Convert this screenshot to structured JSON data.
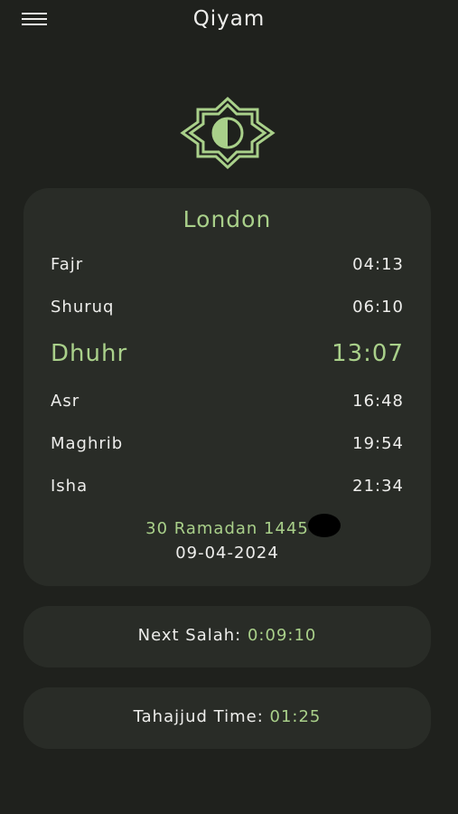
{
  "header": {
    "title": "Qiyam",
    "menu_icon": "hamburger-menu-icon"
  },
  "logo": {
    "icon": "eight-point-star-moon-icon",
    "color": "#a9d08a"
  },
  "prayer_card": {
    "city": "London",
    "prayers": [
      {
        "name": "Fajr",
        "time": "04:13"
      },
      {
        "name": "Shuruq",
        "time": "06:10"
      },
      {
        "name": "Dhuhr",
        "time": "13:07"
      },
      {
        "name": "Asr",
        "time": "16:48"
      },
      {
        "name": "Maghrib",
        "time": "19:54"
      },
      {
        "name": "Isha",
        "time": "21:34"
      }
    ],
    "active_prayer": "Dhuhr",
    "hijri_date": "30 Ramadan 1445",
    "gregorian_date": "09-04-2024"
  },
  "next_salah": {
    "label": "Next Salah:",
    "value": "0:09:10"
  },
  "tahajjud": {
    "label": "Tahajjud Time:",
    "value": "01:25"
  },
  "colors": {
    "background": "#1f211d",
    "card": "#292c27",
    "accent": "#a9d08a",
    "text": "#ededeb"
  }
}
